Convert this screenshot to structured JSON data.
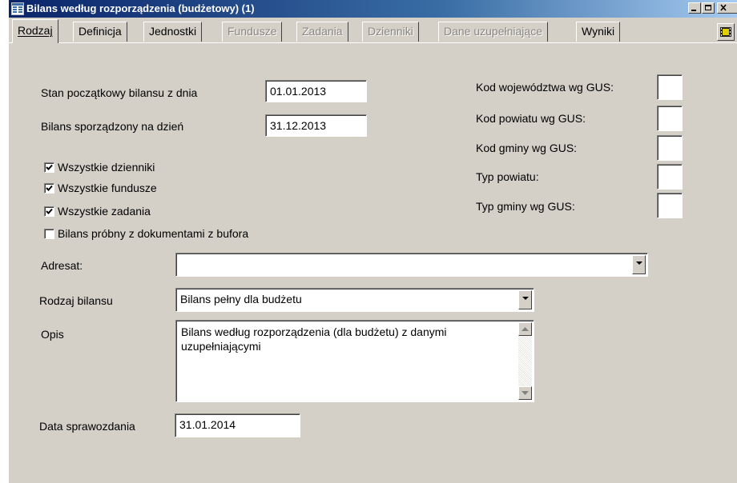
{
  "window": {
    "title": "Bilans według rozporządzenia (budżetowy) (1)"
  },
  "tabs": [
    {
      "label": "Rodzaj",
      "state": "active"
    },
    {
      "label": "Definicja",
      "state": "enabled"
    },
    {
      "label": "Jednostki",
      "state": "enabled"
    },
    {
      "label": "Fundusze",
      "state": "disabled"
    },
    {
      "label": "Zadania",
      "state": "disabled"
    },
    {
      "label": "Dzienniki",
      "state": "disabled"
    },
    {
      "label": "Dane uzupełniające",
      "state": "disabled"
    },
    {
      "label": "Wyniki",
      "state": "enabled"
    }
  ],
  "form": {
    "stan_poczatkowy_label": "Stan początkowy bilansu z dnia",
    "stan_poczatkowy_value": "01.01.2013",
    "bilans_sporzadzony_label": "Bilans sporządzony na dzień",
    "bilans_sporzadzony_value": "31.12.2013",
    "checkboxes": [
      {
        "label": "Wszystkie dzienniki",
        "checked": true
      },
      {
        "label": "Wszystkie fundusze",
        "checked": true
      },
      {
        "label": "Wszystkie zadania",
        "checked": true
      },
      {
        "label": "Bilans próbny z dokumentami z bufora",
        "checked": false
      }
    ],
    "adresat_label": "Adresat:",
    "adresat_value": "",
    "rodzaj_label": "Rodzaj bilansu",
    "rodzaj_value": "Bilans pełny dla budżetu",
    "opis_label": "Opis",
    "opis_value": "Bilans według rozporządzenia (dla budżetu) z danymi uzupełniającymi",
    "data_label": "Data sprawozdania",
    "data_value": "31.01.2014"
  },
  "gus": {
    "wojewodztwo_label": "Kod województwa wg GUS:",
    "powiat_label": "Kod powiatu wg GUS:",
    "gmina_label": "Kod gminy wg GUS:",
    "typ_powiatu_label": "Typ powiatu:",
    "typ_gminy_label": "Typ gminy wg GUS:"
  },
  "colors": {
    "titlebar_start": "#0a246a",
    "titlebar_end": "#a6caf0",
    "face": "#d4d0c8",
    "disabled_text": "#8a8680"
  },
  "icons": {
    "title": "table-window-icon",
    "minimize": "minimize-icon",
    "restore": "restore-icon",
    "close": "close-icon",
    "film": "film-icon",
    "dropdown": "chevron-down-icon"
  }
}
